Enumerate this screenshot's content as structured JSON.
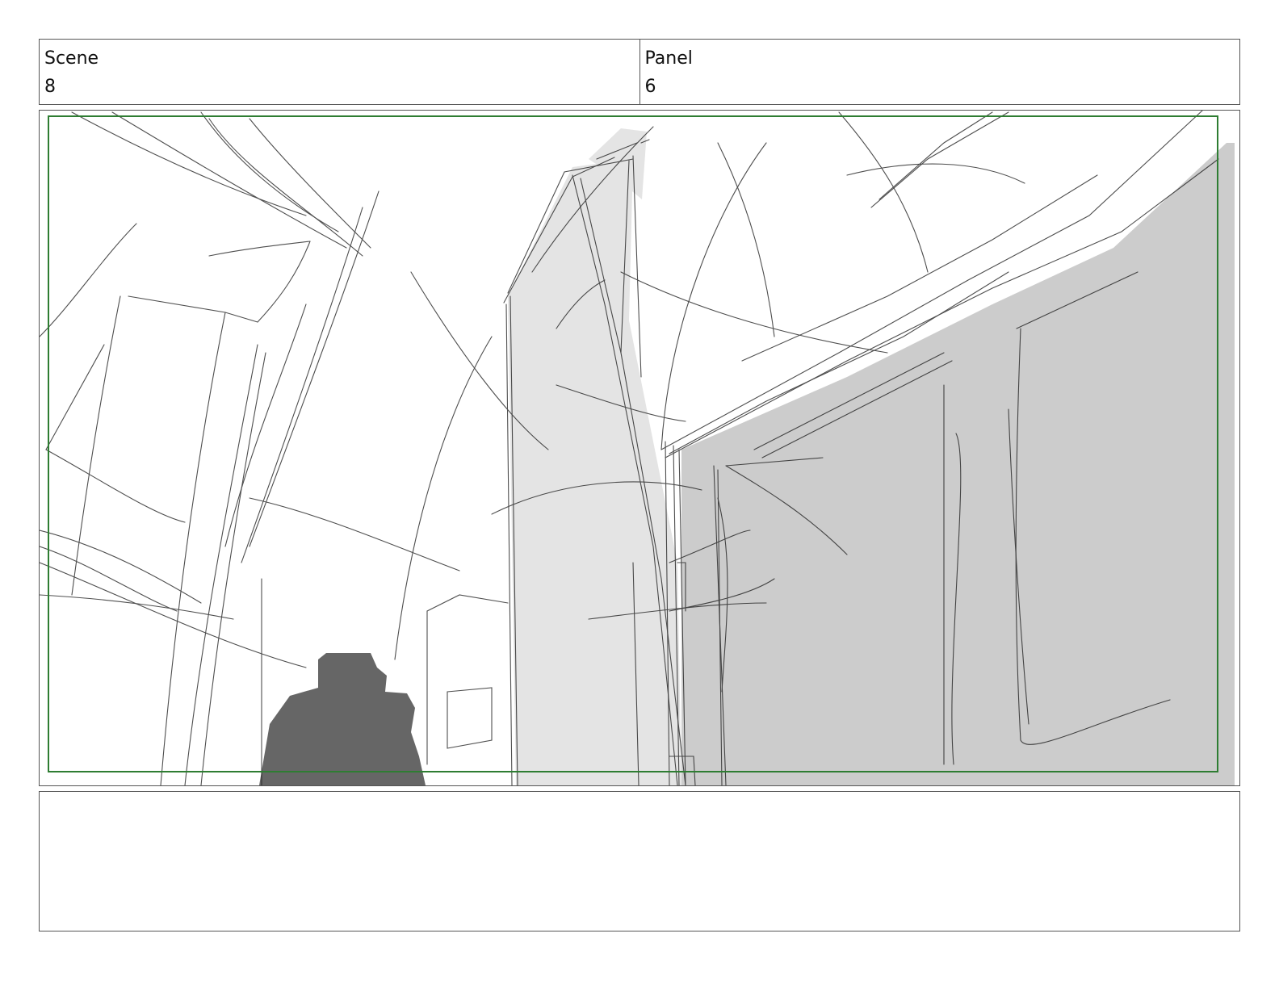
{
  "header": {
    "scene_label": "Scene",
    "scene_value": "8",
    "panel_label": "Panel",
    "panel_value": "6"
  },
  "panel": {
    "safe_frame_color": "#2e7d32",
    "sketch_line_color": "#222222",
    "light_fill": "#e4e4e4",
    "mid_fill": "#cccccc",
    "figure_fill": "#666666"
  },
  "notes": {
    "text": ""
  }
}
